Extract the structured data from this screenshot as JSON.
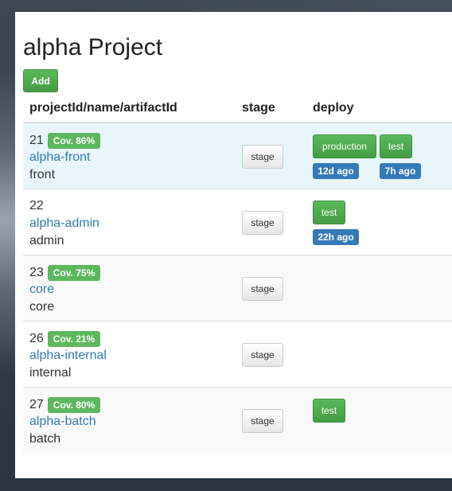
{
  "page": {
    "title": "alpha Project",
    "add_label": "Add"
  },
  "table": {
    "headers": [
      "projectId/name/artifactId",
      "stage",
      "deploy"
    ],
    "rows": [
      {
        "id": "21",
        "coverage": "Cov. 86%",
        "name": "alpha-front",
        "artifact": "front",
        "stage_label": "stage",
        "deploy": [
          {
            "label": "production",
            "ago": "12d ago"
          },
          {
            "label": "test",
            "ago": "7h ago"
          }
        ]
      },
      {
        "id": "22",
        "coverage": "",
        "name": "alpha-admin",
        "artifact": "admin",
        "stage_label": "stage",
        "deploy": [
          {
            "label": "test",
            "ago": "22h ago"
          }
        ]
      },
      {
        "id": "23",
        "coverage": "Cov. 75%",
        "name": "core",
        "artifact": "core",
        "stage_label": "stage",
        "deploy": []
      },
      {
        "id": "26",
        "coverage": "Cov. 21%",
        "name": "alpha-internal",
        "artifact": "internal",
        "stage_label": "stage",
        "deploy": []
      },
      {
        "id": "27",
        "coverage": "Cov. 80%",
        "name": "alpha-batch",
        "artifact": "batch",
        "stage_label": "stage",
        "deploy": [
          {
            "label": "test",
            "ago": ""
          }
        ]
      }
    ]
  },
  "colors": {
    "success": "#5cb85c",
    "primary": "#337ab7",
    "highlight_row": "#e8f6fc"
  }
}
